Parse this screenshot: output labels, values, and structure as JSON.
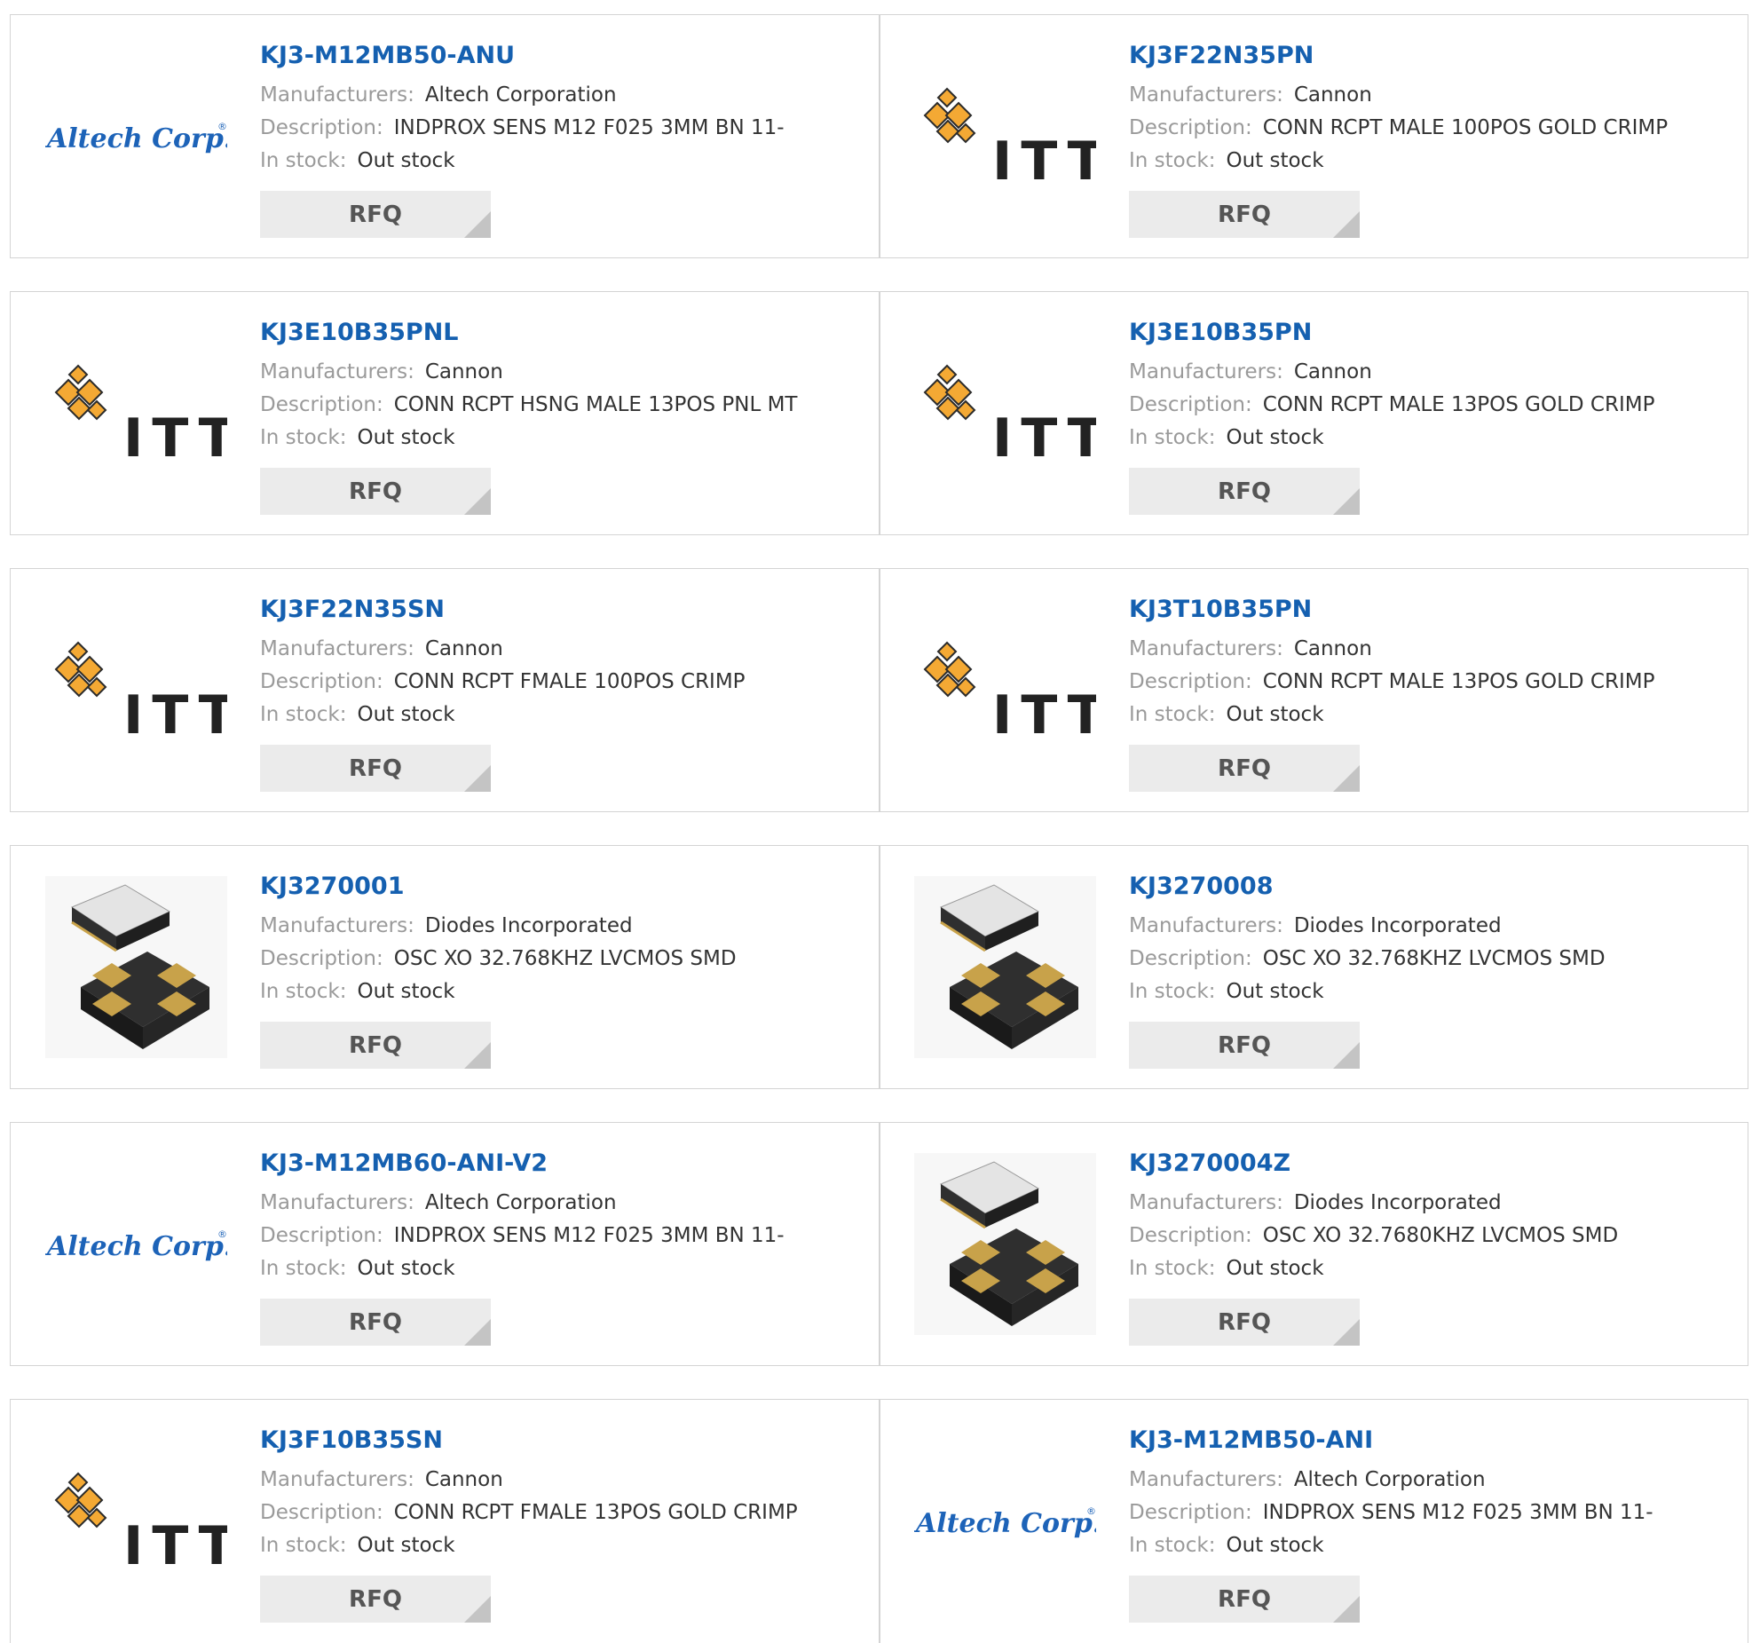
{
  "labels": {
    "manufacturers": "Manufacturers:",
    "description": "Description:",
    "in_stock": "In stock:"
  },
  "logos": {
    "altech": {
      "text": "Altech Corp.",
      "mark": "®",
      "color": "#1d63b8"
    },
    "itt": {
      "text": "ITT",
      "diamond_color": "#f4a934",
      "text_color": "#222222"
    },
    "chip": {
      "body_color": "#2f2f2f",
      "pad_color": "#c8a24a",
      "lid_color": "#e4e4e4"
    }
  },
  "products": [
    {
      "part": "KJ3-M12MB50-ANU",
      "manufacturer": "Altech Corporation",
      "description": "INDPROX SENS M12 F025 3MM BN 11-",
      "stock": "Out stock",
      "logo": "altech",
      "rfq": "RFQ"
    },
    {
      "part": "KJ3F22N35PN",
      "manufacturer": "Cannon",
      "description": "CONN RCPT MALE 100POS GOLD CRIMP",
      "stock": "Out stock",
      "logo": "itt",
      "rfq": "RFQ"
    },
    {
      "part": "KJ3E10B35PNL",
      "manufacturer": "Cannon",
      "description": "CONN RCPT HSNG MALE 13POS PNL MT",
      "stock": "Out stock",
      "logo": "itt",
      "rfq": "RFQ"
    },
    {
      "part": "KJ3E10B35PN",
      "manufacturer": "Cannon",
      "description": "CONN RCPT MALE 13POS GOLD CRIMP",
      "stock": "Out stock",
      "logo": "itt",
      "rfq": "RFQ"
    },
    {
      "part": "KJ3F22N35SN",
      "manufacturer": "Cannon",
      "description": "CONN RCPT FMALE 100POS CRIMP",
      "stock": "Out stock",
      "logo": "itt",
      "rfq": "RFQ"
    },
    {
      "part": "KJ3T10B35PN",
      "manufacturer": "Cannon",
      "description": "CONN RCPT MALE 13POS GOLD CRIMP",
      "stock": "Out stock",
      "logo": "itt",
      "rfq": "RFQ"
    },
    {
      "part": "KJ3270001",
      "manufacturer": "Diodes Incorporated",
      "description": "OSC XO 32.768KHZ LVCMOS SMD",
      "stock": "Out stock",
      "logo": "chip",
      "rfq": "RFQ"
    },
    {
      "part": "KJ3270008",
      "manufacturer": "Diodes Incorporated",
      "description": "OSC XO 32.768KHZ LVCMOS SMD",
      "stock": "Out stock",
      "logo": "chip",
      "rfq": "RFQ"
    },
    {
      "part": "KJ3-M12MB60-ANI-V2",
      "manufacturer": "Altech Corporation",
      "description": "INDPROX SENS M12 F025 3MM BN 11-",
      "stock": "Out stock",
      "logo": "altech",
      "rfq": "RFQ"
    },
    {
      "part": "KJ3270004Z",
      "manufacturer": "Diodes Incorporated",
      "description": "OSC XO 32.7680KHZ LVCMOS SMD",
      "stock": "Out stock",
      "logo": "chip",
      "rfq": "RFQ"
    },
    {
      "part": "KJ3F10B35SN",
      "manufacturer": "Cannon",
      "description": "CONN RCPT FMALE 13POS GOLD CRIMP",
      "stock": "Out stock",
      "logo": "itt",
      "rfq": "RFQ"
    },
    {
      "part": "KJ3-M12MB50-ANI",
      "manufacturer": "Altech Corporation",
      "description": "INDPROX SENS M12 F025 3MM BN 11-",
      "stock": "Out stock",
      "logo": "altech",
      "rfq": "RFQ"
    }
  ]
}
